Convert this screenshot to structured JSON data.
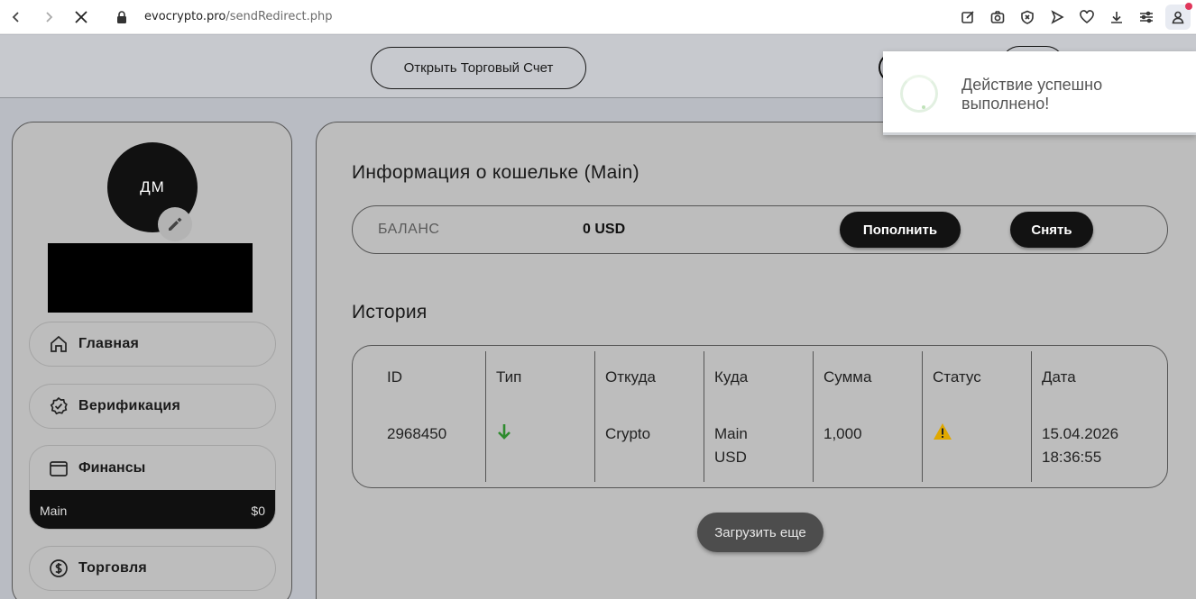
{
  "browser": {
    "url_host": "evocrypto.pro",
    "url_path": "/sendRedirect.php",
    "back_icon": "chevron-left-icon",
    "forward_icon": "chevron-right-icon",
    "stop_icon": "close-icon"
  },
  "topbar": {
    "open_account_label": "Открыть Торговый Счет"
  },
  "sidebar": {
    "avatar_initials": "ДМ",
    "menu": {
      "home": "Главная",
      "verification": "Верификация",
      "finance": "Финансы",
      "trading": "Торговля"
    },
    "finance_sub": {
      "wallet_name": "Main",
      "wallet_amount": "$0"
    }
  },
  "wallet": {
    "title": "Информация о кошельке (Main)",
    "balance_label": "БАЛАНС",
    "balance_value": "0 USD",
    "deposit_label": "Пополнить",
    "withdraw_label": "Снять"
  },
  "history": {
    "title": "История",
    "columns": [
      "ID",
      "Тип",
      "Откуда",
      "Куда",
      "Сумма",
      "Статус",
      "Дата"
    ],
    "rows": [
      {
        "id": "2968450",
        "type_icon": "arrow-down-icon",
        "from": "Crypto",
        "to_line1": "Main",
        "to_line2": "USD",
        "amount": "1,000",
        "status_icon": "warning-icon",
        "date_line1": "15.04.2026",
        "date_line2": "18:36:55"
      }
    ],
    "load_more_label": "Загрузить еще"
  },
  "toast": {
    "line1": "Действие успешно",
    "line2": "выполнено!"
  },
  "colors": {
    "accent_dark": "#121212",
    "positive_arrow": "#2e8b2e",
    "warning": "#e0a800"
  }
}
